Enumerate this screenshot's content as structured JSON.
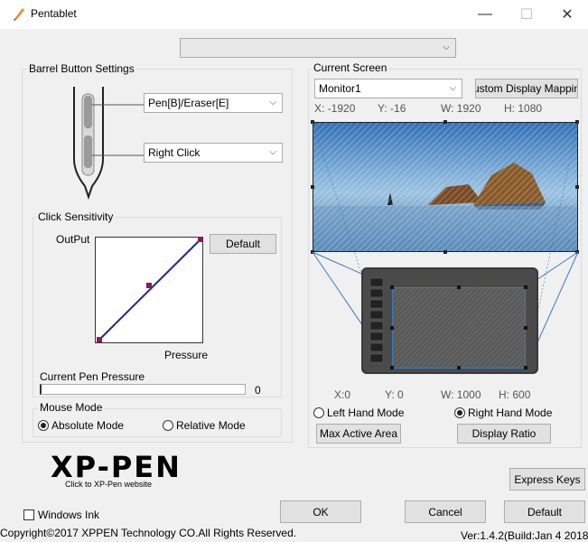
{
  "window": {
    "title": "Pentablet",
    "minimize_icon": "—",
    "maximize_icon": "☐",
    "close_icon": "✕"
  },
  "top_dropdown": {
    "value": ""
  },
  "barrel": {
    "group_label": "Barrel Button Settings",
    "upper_button": "Pen[B]/Eraser[E]",
    "lower_button": "Right Click"
  },
  "sensitivity": {
    "group_label": "Click Sensitivity",
    "output_label": "OutPut",
    "pressure_label": "Pressure",
    "default_button": "Default",
    "current_pressure_label": "Current Pen Pressure",
    "current_pressure_value": "0"
  },
  "mouse_mode": {
    "group_label": "Mouse Mode",
    "absolute": "Absolute Mode",
    "relative": "Relative Mode"
  },
  "logo": {
    "text": "XP-PEN",
    "link": "Click to XP-Pen website"
  },
  "screen": {
    "group_label": "Current Screen",
    "monitor": "Monitor1",
    "custom_mapping_button": "ustom Display Mappin",
    "x_label": "X:",
    "x_value": "-1920",
    "y_label": "Y:",
    "y_value": "-16",
    "w_label": "W:",
    "w_value": "1920",
    "h_label": "H:",
    "h_value": "1080"
  },
  "tablet": {
    "x_label": "X:",
    "x_value": "0",
    "y_label": "Y:",
    "y_value": "0",
    "w_label": "W:",
    "w_value": "1000",
    "h_label": "H:",
    "h_value": "600",
    "left_hand": "Left Hand Mode",
    "right_hand": "Right Hand Mode",
    "max_active_area": "Max Active Area",
    "display_ratio": "Display Ratio"
  },
  "bottom": {
    "express_keys": "Express Keys",
    "windows_ink": "Windows Ink",
    "ok": "OK",
    "cancel": "Cancel",
    "default": "Default",
    "copyright": "Copyright©2017 XPPEN Technology CO.All Rights Reserved.",
    "version": "Ver:1.4.2(Build:Jan  4 2018"
  }
}
